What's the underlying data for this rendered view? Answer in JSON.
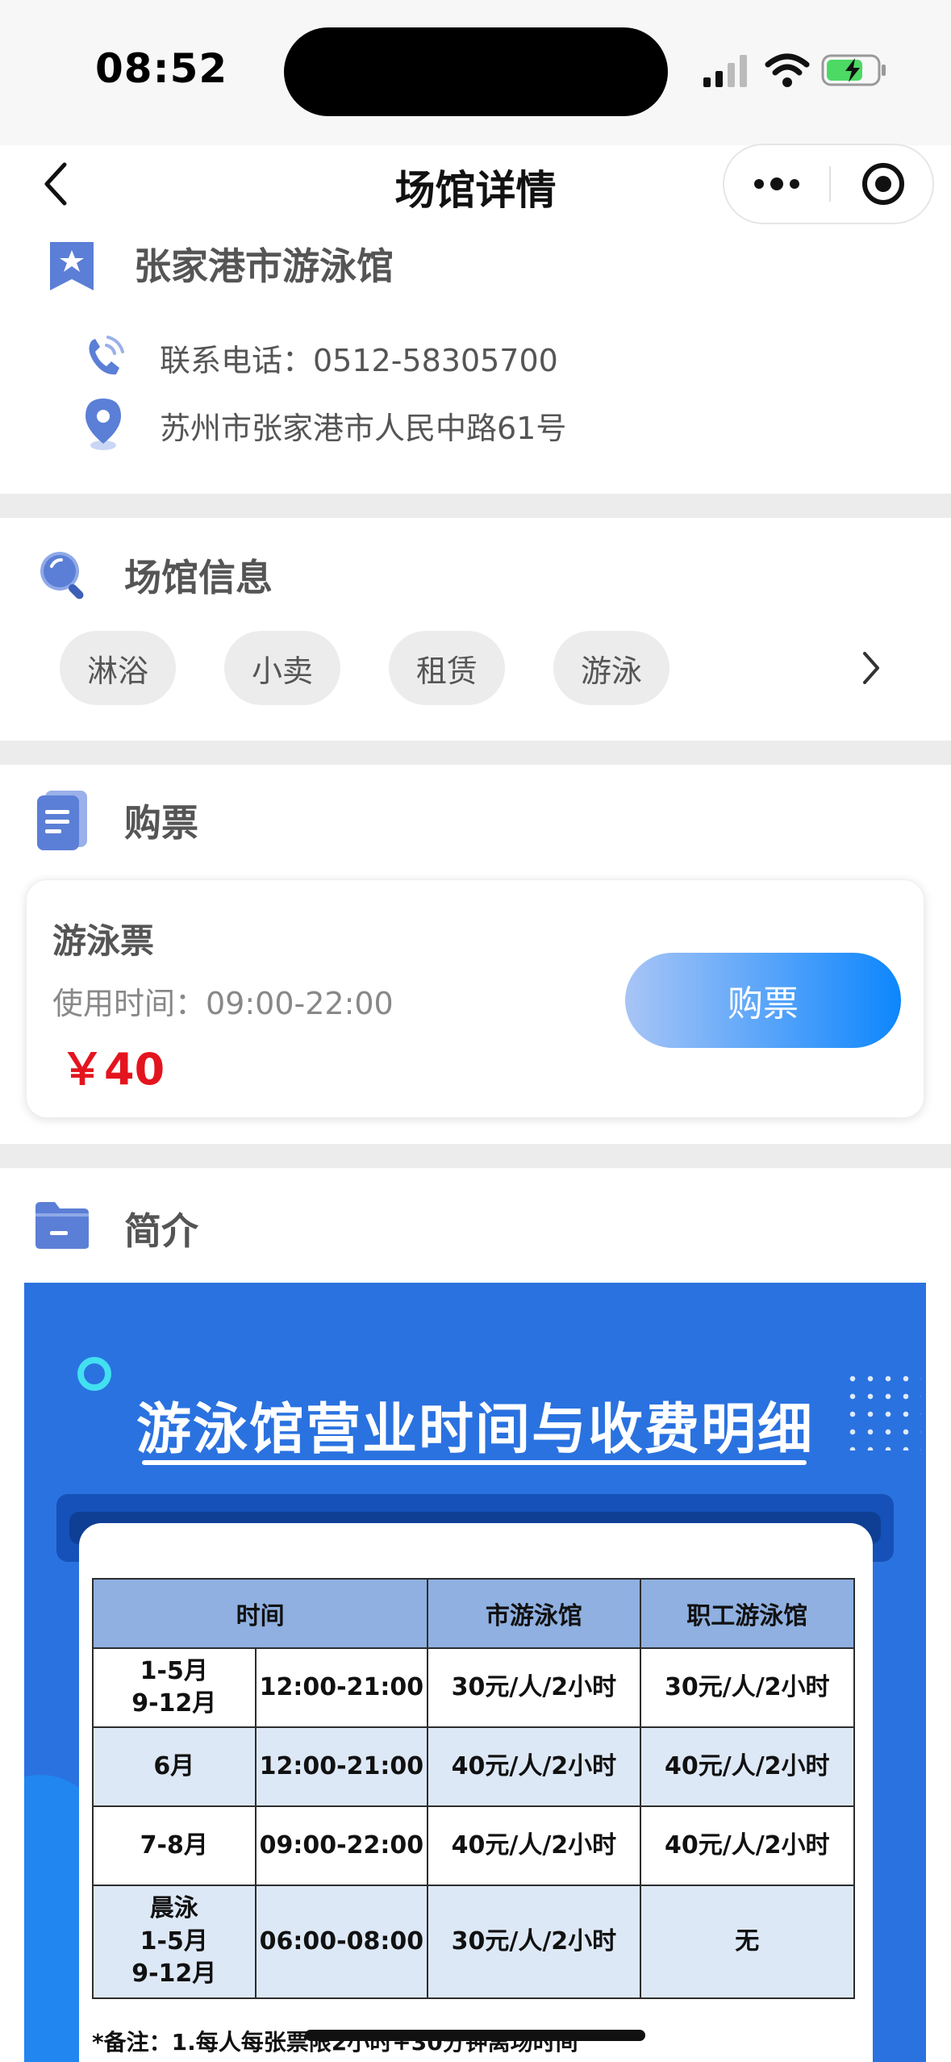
{
  "status_bar": {
    "time": "08:52",
    "battery_color": "#4cd964"
  },
  "nav": {
    "title": "场馆详情"
  },
  "venue": {
    "name": "张家港市游泳馆",
    "phone": "联系电话：0512-58305700",
    "address": "苏州市张家港市人民中路61号"
  },
  "info_section": {
    "title": "场馆信息",
    "tags": [
      "淋浴",
      "小卖",
      "租赁",
      "游泳"
    ]
  },
  "ticket_section": {
    "title": "购票",
    "ticket": {
      "name": "游泳票",
      "time": "使用时间：09:00-22:00",
      "price": "￥40",
      "buy_label": "购票"
    }
  },
  "intro_section": {
    "title": "简介",
    "poster": {
      "title": "游泳馆营业时间与收费明细",
      "table": {
        "headers": [
          "时间",
          "市游泳馆",
          "职工游泳馆"
        ],
        "rows": [
          {
            "period": "1-5月\n9-12月",
            "hours": "12:00-21:00",
            "city": "30元/人/2小时",
            "staff": "30元/人/2小时"
          },
          {
            "period": "6月",
            "hours": "12:00-21:00",
            "city": "40元/人/2小时",
            "staff": "40元/人/2小时"
          },
          {
            "period": "7-8月",
            "hours": "09:00-22:00",
            "city": "40元/人/2小时",
            "staff": "40元/人/2小时"
          },
          {
            "period": "晨泳\n1-5月\n9-12月",
            "hours": "06:00-08:00",
            "city": "30元/人/2小时",
            "staff": "无"
          }
        ]
      },
      "note": "*备注：1.每人每张票限2小时+30分钟离场时间"
    }
  },
  "colors": {
    "accent": "#0d86fd",
    "price": "#e4141e",
    "poster_bg": "#2a72e0"
  }
}
